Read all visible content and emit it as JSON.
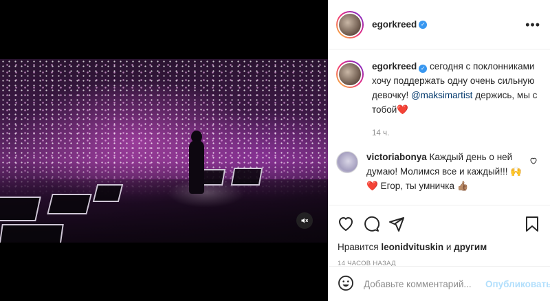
{
  "post_author": {
    "username": "egorkreed",
    "verified_icon": "verified-badge-icon"
  },
  "header": {
    "more_icon": "more-options-icon",
    "more_label": "•••"
  },
  "caption": {
    "username": "egorkreed",
    "text_before_mention": " сегодня с поклонниками хочу поддержать одну очень сильную девочку! ",
    "mention": "@maksimartist",
    "text_after_mention": " держись, мы с тобой",
    "emoji": "❤️",
    "time": "14 ч."
  },
  "comment": {
    "username": "victoriabonya",
    "text": " Каждый день о ней думаю! Молимся все и каждый!!! 🙌❤️ Егор, ты умничка 👍🏽"
  },
  "actions": {
    "like_icon": "heart-icon",
    "comment_icon": "comment-icon",
    "share_icon": "share-icon",
    "save_icon": "bookmark-icon"
  },
  "likes": {
    "prefix": "Нравится ",
    "user": "leonidvituskin",
    "suffix": " и ",
    "others": "другим"
  },
  "timestamp": "14 часов назад",
  "add_comment": {
    "emoji_icon": "emoji-icon",
    "placeholder": "Добавьте комментарий...",
    "publish_label": "Опубликовать"
  },
  "media": {
    "type": "video",
    "sound_icon": "speaker-muted-icon"
  },
  "colors": {
    "link": "#00376b",
    "verified": "#3897f0",
    "publish_disabled": "#b2dffc",
    "muted_text": "#8e8e8e"
  }
}
